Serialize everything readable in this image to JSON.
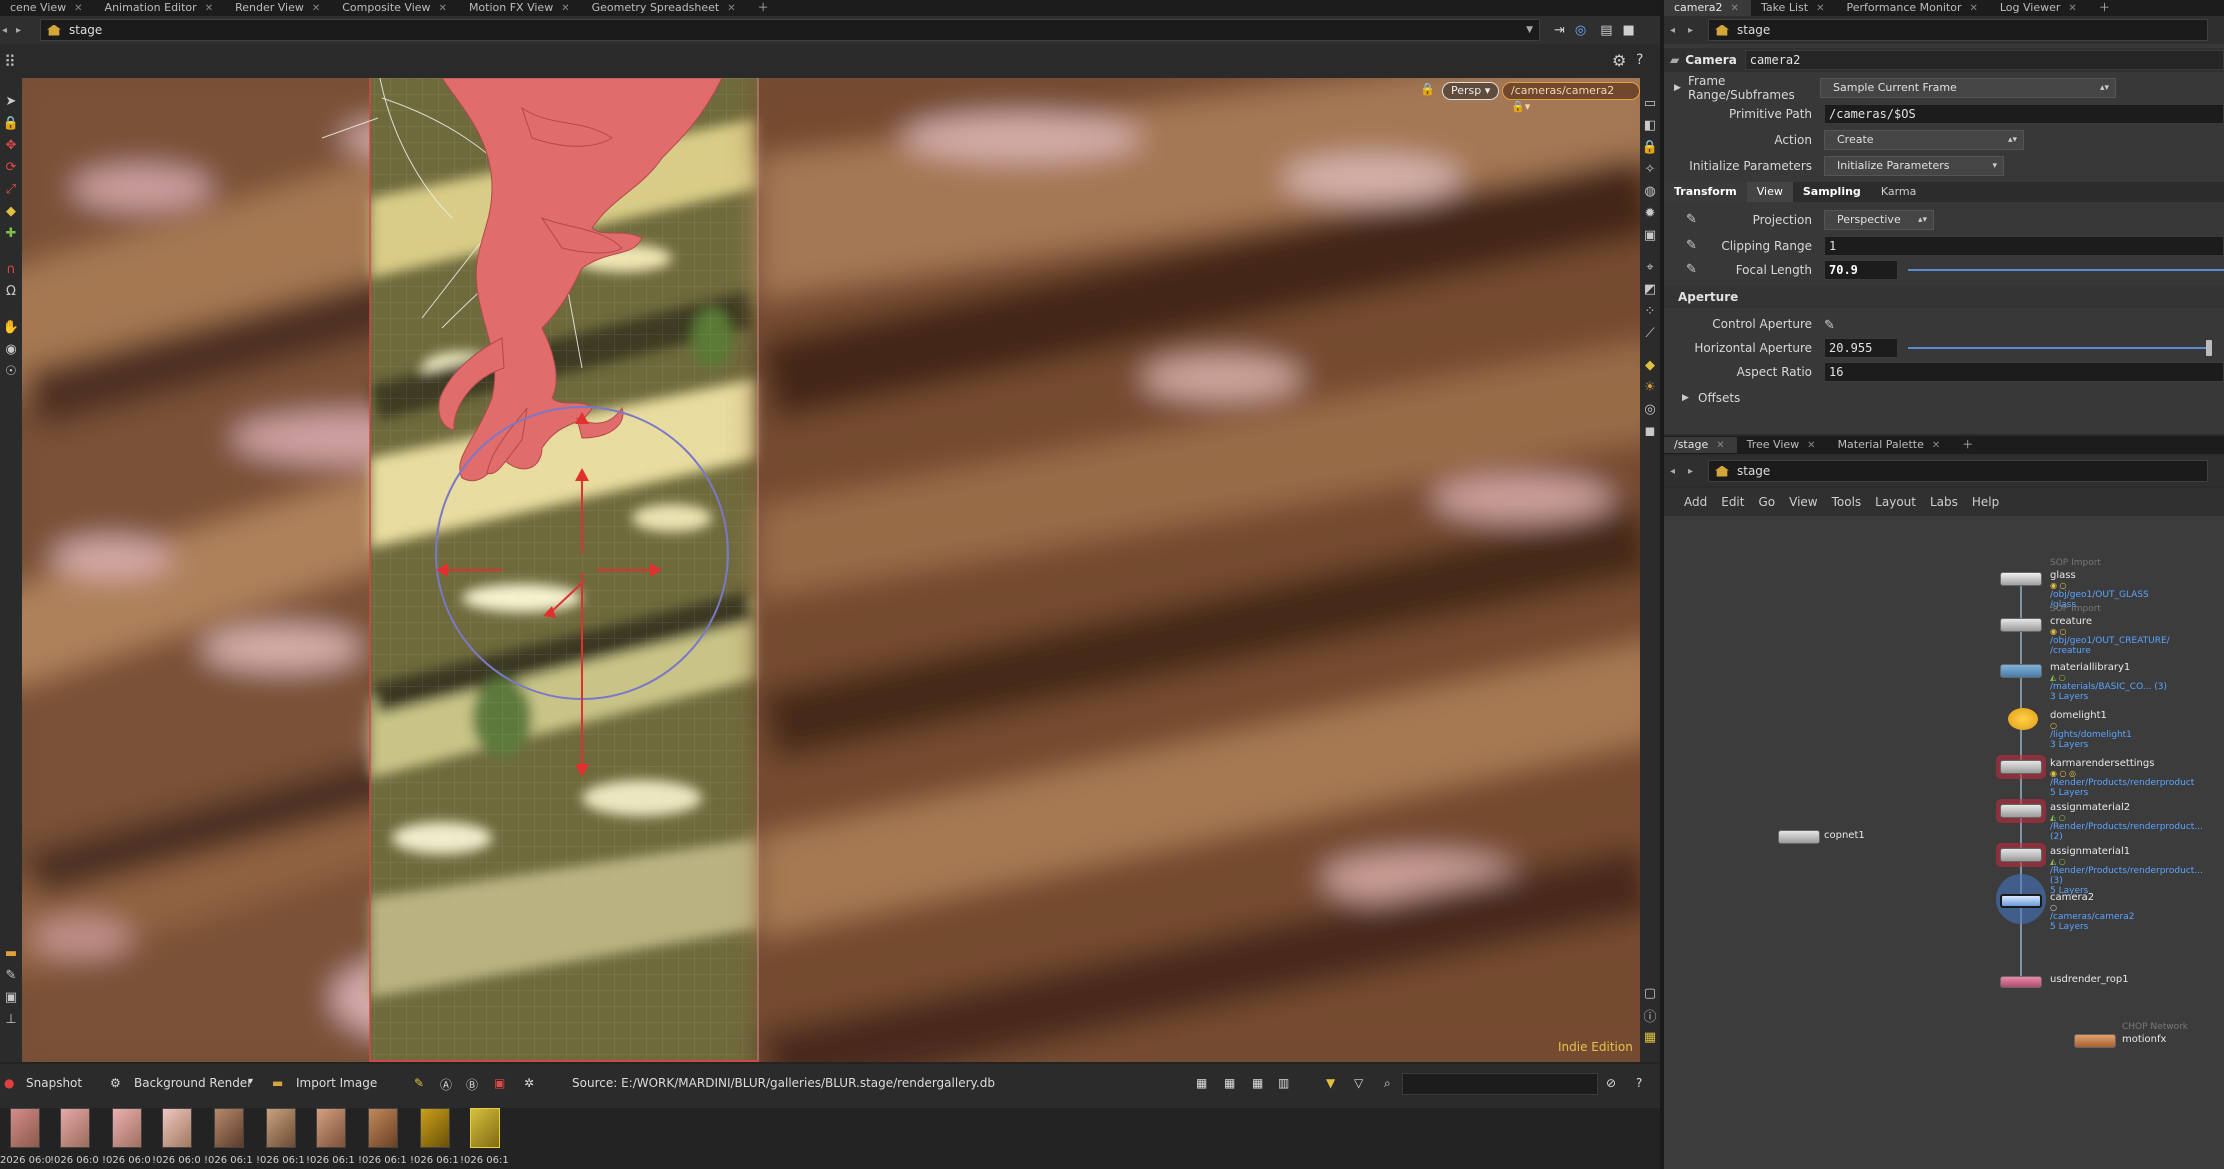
{
  "left_tabs": [
    "cene View",
    "Animation Editor",
    "Render View",
    "Composite View",
    "Motion FX View",
    "Geometry Spreadsheet"
  ],
  "left_path": "stage",
  "right_tabs": [
    "camera2",
    "Take List",
    "Performance Monitor",
    "Log Viewer"
  ],
  "right_path": "stage",
  "viewport": {
    "persp_label": "Persp",
    "camera_label": "/cameras/camera2",
    "edition": "Indie Edition"
  },
  "node_header": {
    "type": "Camera",
    "name": "camera2"
  },
  "parms": {
    "frame_range_label": "Frame Range/Subframes",
    "frame_range_value": "Sample Current Frame",
    "prim_path_label": "Primitive Path",
    "prim_path_value": "/cameras/$OS",
    "action_label": "Action",
    "action_value": "Create",
    "init_label": "Initialize Parameters",
    "init_value": "Initialize Parameters",
    "tabs": [
      "Transform",
      "View",
      "Sampling",
      "Karma"
    ],
    "projection_label": "Projection",
    "projection_value": "Perspective",
    "clipping_label": "Clipping Range",
    "clipping_value": "1",
    "focal_label": "Focal Length",
    "focal_value": "70.9",
    "aperture_header": "Aperture",
    "control_aperture_label": "Control Aperture",
    "h_aperture_label": "Horizontal Aperture",
    "h_aperture_value": "20.955",
    "aspect_label": "Aspect Ratio",
    "aspect_value": "16",
    "offsets_label": "Offsets"
  },
  "network_tabs": [
    "/stage",
    "Tree View",
    "Material Palette"
  ],
  "network_path": "stage",
  "network_menu": [
    "Add",
    "Edit",
    "Go",
    "View",
    "Tools",
    "Layout",
    "Labs",
    "Help"
  ],
  "nodes": [
    {
      "type": "SOP Import",
      "name": "glass",
      "sub": "/obj/geo1/OUT_GLASS\n/glass"
    },
    {
      "type": "SOP Import",
      "name": "creature",
      "sub": "/obj/geo1/OUT_CREATURE/\n/creature"
    },
    {
      "type": "",
      "name": "materiallibrary1",
      "sub": "/materials/BASIC_CO... (3)\n3 Layers"
    },
    {
      "type": "",
      "name": "domelight1",
      "sub": "/lights/domelight1\n3 Layers"
    },
    {
      "type": "",
      "name": "karmarendersettings",
      "sub": "/Render/Products/renderproduct\n5 Layers"
    },
    {
      "type": "",
      "name": "assignmaterial2",
      "sub": "/Render/Products/renderproduct...\n(2)"
    },
    {
      "type": "",
      "name": "assignmaterial1",
      "sub": "/Render/Products/renderproduct...\n(3)\n5 Layers"
    },
    {
      "type": "",
      "name": "camera2",
      "sub": "/cameras/camera2\n5 Layers"
    },
    {
      "type": "",
      "name": "usdrender_rop1",
      "sub": ""
    },
    {
      "type": "",
      "name": "copnet1",
      "sub": ""
    },
    {
      "type": "CHOP Network",
      "name": "motionfx",
      "sub": ""
    }
  ],
  "statusbar": {
    "snapshot": "Snapshot",
    "background_render": "Background Render",
    "import_image": "Import Image",
    "source": "Source: E:/WORK/MARDINI/BLUR/galleries/BLUR.stage/rendergallery.db"
  },
  "thumbnails": [
    "2026 06:0",
    "!026 06:0",
    "!026 06:0",
    "!026 06:0",
    "!026 06:1",
    "!026 06:1",
    "!026 06:1",
    "!026 06:1",
    "!026 06:1",
    "!026 06:1"
  ]
}
